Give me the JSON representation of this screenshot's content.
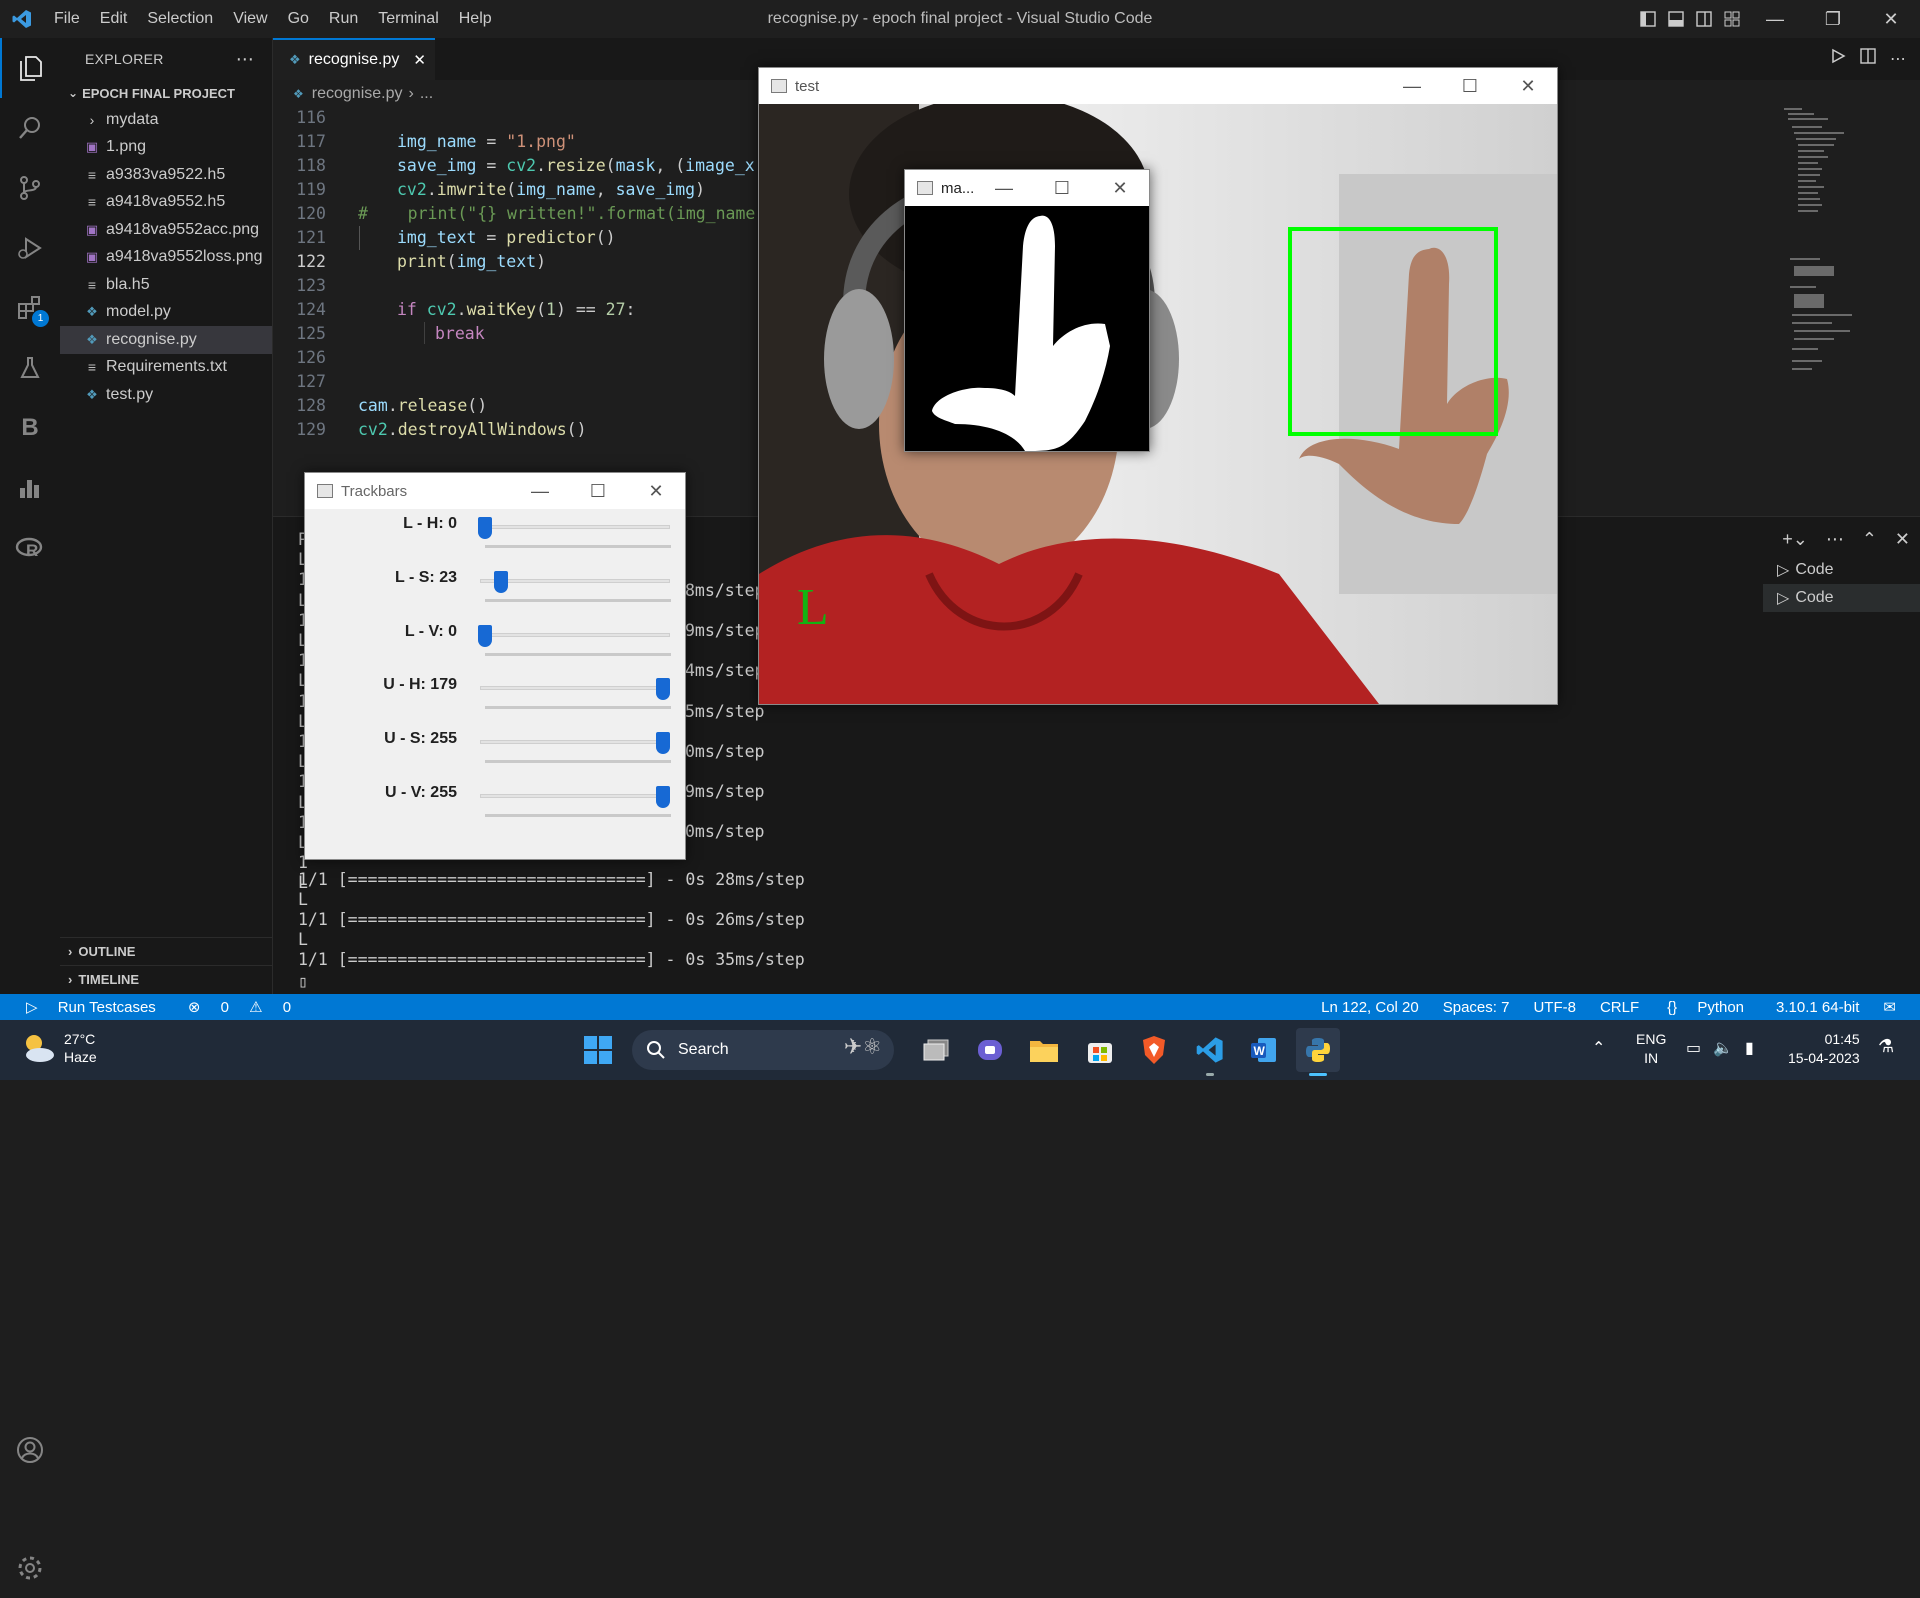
{
  "titlebar": {
    "menu": [
      "File",
      "Edit",
      "Selection",
      "View",
      "Go",
      "Run",
      "Terminal",
      "Help"
    ],
    "window_title": "recognise.py - epoch final project - Visual Studio Code"
  },
  "sidebar": {
    "header": "EXPLORER",
    "project": "EPOCH FINAL PROJECT",
    "items": [
      {
        "label": "mydata",
        "icon": "chevron-right-icon"
      },
      {
        "label": "1.png",
        "icon": "image-file-icon"
      },
      {
        "label": "a9383va9522.h5",
        "icon": "text-file-icon"
      },
      {
        "label": "a9418va9552.h5",
        "icon": "text-file-icon"
      },
      {
        "label": "a9418va9552acc.png",
        "icon": "image-file-icon"
      },
      {
        "label": "a9418va9552loss.png",
        "icon": "image-file-icon"
      },
      {
        "label": "bla.h5",
        "icon": "text-file-icon"
      },
      {
        "label": "model.py",
        "icon": "python-file-icon"
      },
      {
        "label": "recognise.py",
        "icon": "python-file-icon"
      },
      {
        "label": "Requirements.txt",
        "icon": "text-file-icon"
      },
      {
        "label": "test.py",
        "icon": "python-file-icon"
      }
    ],
    "outline": "OUTLINE",
    "timeline": "TIMELINE"
  },
  "activity": {
    "extensions_badge": "1"
  },
  "editor": {
    "tab": "recognise.py",
    "breadcrumb_file": "recognise.py",
    "breadcrumb_more": "...",
    "line_numbers": [
      "116",
      "117",
      "118",
      "119",
      "120",
      "121",
      "122",
      "123",
      "124",
      "125",
      "126",
      "127",
      "128",
      "129"
    ],
    "current_line": "122"
  },
  "code": {
    "l117_a": "img_name",
    "l117_b": " = ",
    "l117_c": "\"1.png\"",
    "l118_a": "save_img",
    "l118_b": " = ",
    "l118_c": "cv2",
    "l118_d": ".",
    "l118_e": "resize",
    "l118_f": "(",
    "l118_g": "mask",
    "l118_h": ", (",
    "l118_i": "image_x",
    "l118_j": ",",
    "l119_a": "cv2",
    "l119_b": ".",
    "l119_c": "imwrite",
    "l119_d": "(",
    "l119_e": "img_name",
    "l119_f": ", ",
    "l119_g": "save_img",
    "l119_h": ")",
    "l120": "#    print(\"{} written!\".format(img_name)",
    "l121_a": "img_text",
    "l121_b": " = ",
    "l121_c": "predictor",
    "l121_d": "()",
    "l122_a": "print",
    "l122_b": "(",
    "l122_c": "img_text",
    "l122_d": ")",
    "l124_a": "if",
    "l124_b": " cv2",
    "l124_c": ".",
    "l124_d": "waitKey",
    "l124_e": "(",
    "l124_f": "1",
    "l124_g": ") == ",
    "l124_h": "27",
    "l124_i": ":",
    "l125": "break",
    "l128_a": "cam",
    "l128_b": ".",
    "l128_c": "release",
    "l128_d": "()",
    "l129_a": "cv2",
    "l129_b": ".",
    "l129_c": "destroyAllWindows",
    "l129_d": "()"
  },
  "terminal": {
    "left_chars": [
      "P",
      "L",
      "1",
      "L",
      "1",
      "L",
      "1",
      "L",
      "1",
      "L",
      "1",
      "L",
      "1",
      "L",
      "1",
      "L",
      "1",
      "L"
    ],
    "right_steps": [
      "8ms/step",
      "9ms/step",
      "4ms/step",
      "5ms/step",
      "0ms/step",
      "9ms/step",
      "0ms/step"
    ],
    "full_lines": [
      "1/1 [==============================] - 0s 28ms/step",
      "L",
      "1/1 [==============================] - 0s 26ms/step",
      "L",
      "1/1 [==============================] - 0s 35ms/step"
    ],
    "cursor": "▯",
    "list": [
      "Code",
      "Code"
    ]
  },
  "status": {
    "run": "Run Testcases",
    "errors": "0",
    "warnings": "0",
    "position": "Ln 122, Col 20",
    "spaces": "Spaces: 7",
    "encoding": "UTF-8",
    "eol": "CRLF",
    "language": "Python",
    "interpreter": "3.10.1 64-bit"
  },
  "test_window": {
    "title": "test",
    "prediction": "L"
  },
  "mask_window": {
    "title": "ma..."
  },
  "trackbars": {
    "title": "Trackbars",
    "bars": [
      {
        "label": "L - H: 0",
        "value": 0,
        "max": 179
      },
      {
        "label": "L - S: 23",
        "value": 23,
        "max": 255
      },
      {
        "label": "L - V: 0",
        "value": 0,
        "max": 255
      },
      {
        "label": "U - H: 179",
        "value": 179,
        "max": 179
      },
      {
        "label": "U - S: 255",
        "value": 255,
        "max": 255
      },
      {
        "label": "U - V: 255",
        "value": 255,
        "max": 255
      }
    ]
  },
  "taskbar": {
    "weather_temp": "27°C",
    "weather_desc": "Haze",
    "search": "Search",
    "lang_top": "ENG",
    "lang_bottom": "IN",
    "time": "01:45",
    "date": "15-04-2023"
  },
  "colors": {
    "accent": "#0078d4",
    "box_green": "#00ff00",
    "status": "#0078d4"
  }
}
